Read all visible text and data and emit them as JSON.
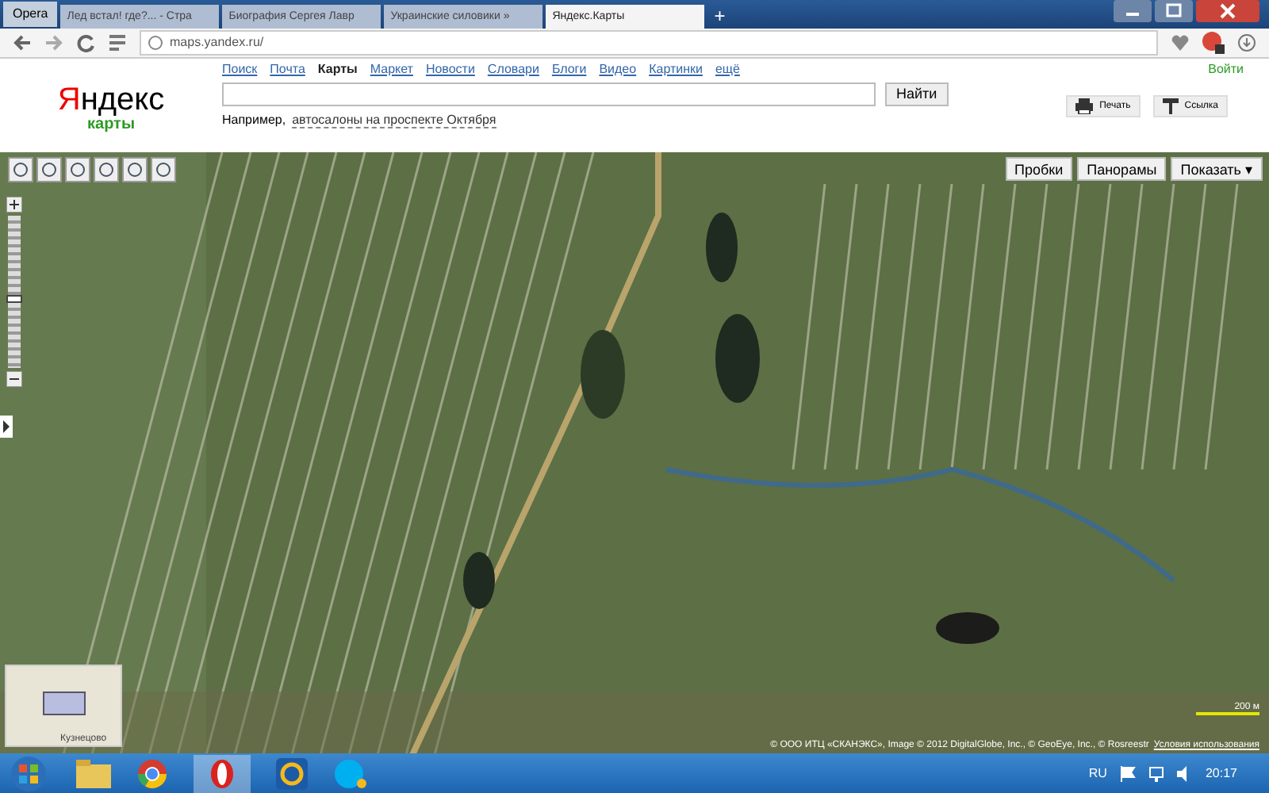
{
  "browser": {
    "menu_label": "Opera",
    "tabs": [
      {
        "title": "Лед встал! где?... - Стра",
        "selected": false
      },
      {
        "title": "Биография Сергея Лавр",
        "selected": false
      },
      {
        "title": "Украинские силовики »",
        "selected": false
      },
      {
        "title": "Яндекс.Карты",
        "selected": true
      }
    ],
    "new_tab": "+",
    "address": "maps.yandex.ru/"
  },
  "header": {
    "logo": "Яндекс",
    "logo_sub": "карты",
    "services": [
      {
        "label": "Поиск",
        "selected": false
      },
      {
        "label": "Почта",
        "selected": false
      },
      {
        "label": "Карты",
        "selected": true
      },
      {
        "label": "Маркет",
        "selected": false
      },
      {
        "label": "Новости",
        "selected": false
      },
      {
        "label": "Словари",
        "selected": false
      },
      {
        "label": "Блоги",
        "selected": false
      },
      {
        "label": "Видео",
        "selected": false
      },
      {
        "label": "Картинки",
        "selected": false
      },
      {
        "label": "ещё",
        "selected": false
      }
    ],
    "search_button": "Найти",
    "example_prefix": "Например,",
    "example_link": "автосалоны на проспекте Октября",
    "print": "Печать",
    "link": "Ссылка",
    "login": "Войти"
  },
  "map": {
    "layers": [
      "Пробки",
      "Панорамы"
    ],
    "show": "Показать ▾",
    "zoom_slider": {
      "level": 0.45
    },
    "scale": "200 м",
    "minimap_label": "Кузнецово",
    "copyright": "© ООО ИТЦ «СКАНЭКС», Image © 2012 DigitalGlobe, Inc., © GeoEye, Inc., © Rosreestr",
    "terms": "Условия использования"
  },
  "taskbar": {
    "language": "RU",
    "time": "20:17"
  }
}
